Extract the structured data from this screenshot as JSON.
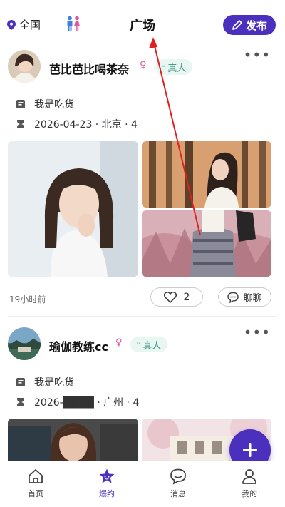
{
  "header": {
    "location": "全国",
    "title": "广场",
    "publish_label": "发布"
  },
  "posts": [
    {
      "username": "芭比芭比喝茶奈",
      "verified_badge": "真人",
      "intro": "我是吃货",
      "meta": "2026-04-23 · 北京 · 4",
      "time": "19小时前",
      "likes": "2",
      "chat_label": "聊聊"
    },
    {
      "username": "瑜伽教练cc",
      "verified_badge": "真人",
      "intro": "我是吃货",
      "meta": "2026-████ · 广州 · 4"
    }
  ],
  "tabs": [
    {
      "label": "首页",
      "icon": "home-icon"
    },
    {
      "label": "爆约",
      "icon": "star-icon",
      "active": true
    },
    {
      "label": "消息",
      "icon": "chat-bubble-icon"
    },
    {
      "label": "我的",
      "icon": "person-icon"
    }
  ],
  "colors": {
    "accent": "#4b2fbd",
    "badge_bg": "#e9f7f3",
    "badge_text": "#3d8f80",
    "female": "#e0569d",
    "annotation_arrow": "#e02020"
  }
}
